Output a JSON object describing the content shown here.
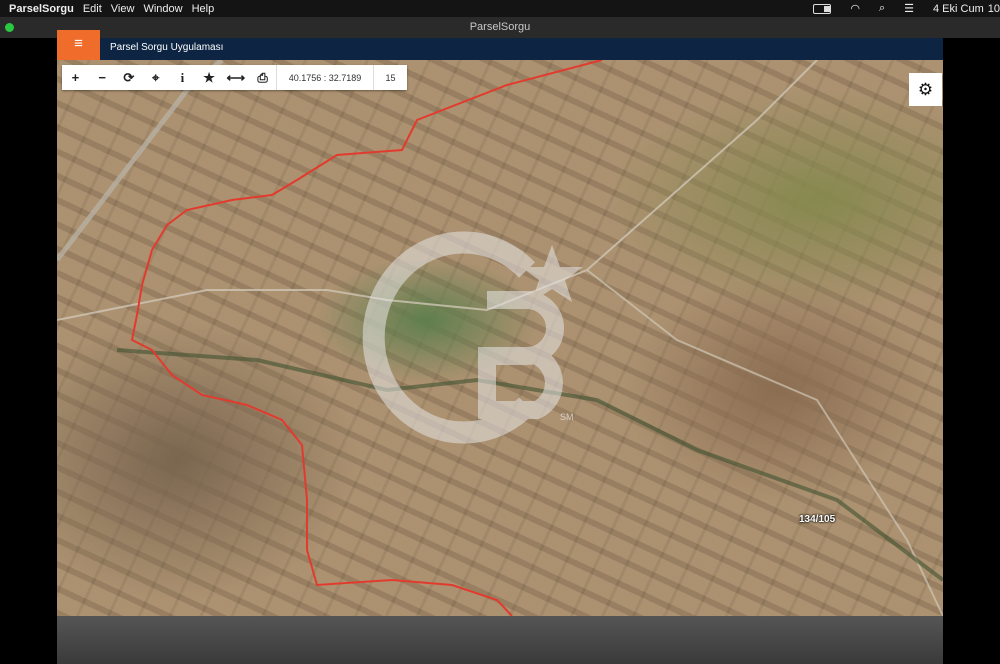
{
  "menubar": {
    "app_name": "ParselSorgu",
    "items": [
      "Edit",
      "View",
      "Window",
      "Help"
    ],
    "date": "4 Eki Cum",
    "time_partial": "10"
  },
  "window": {
    "title": "ParselSorgu"
  },
  "app": {
    "title": "Parsel Sorgu Uygulaması",
    "menu_icon": "hamburger-icon"
  },
  "toolbar": {
    "tools": [
      {
        "name": "zoom-in-icon",
        "glyph": "+"
      },
      {
        "name": "zoom-out-icon",
        "glyph": "−"
      },
      {
        "name": "refresh-icon",
        "glyph": "⟳"
      },
      {
        "name": "locate-icon",
        "glyph": "⌖"
      },
      {
        "name": "info-icon",
        "glyph": "i"
      },
      {
        "name": "favorite-star-icon",
        "glyph": "★"
      },
      {
        "name": "measure-icon",
        "glyph": "⟷"
      },
      {
        "name": "print-icon",
        "glyph": "⎙"
      }
    ],
    "coordinates": "40.1756 : 32.7189",
    "zoom_level": "15"
  },
  "map": {
    "parcel_label": "134/105",
    "watermark": "CB",
    "watermark_mark": "SM",
    "boundary_color": "#e23b2e"
  },
  "settings": {
    "icon": "gear-icon"
  }
}
